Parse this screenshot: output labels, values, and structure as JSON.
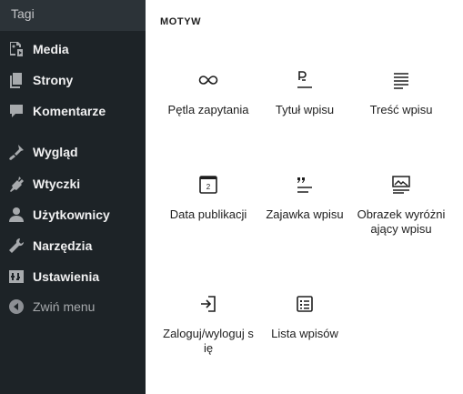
{
  "sidebar": {
    "top_item": "Tagi",
    "items": [
      {
        "label": "Media",
        "icon": "media-icon"
      },
      {
        "label": "Strony",
        "icon": "pages-icon"
      },
      {
        "label": "Komentarze",
        "icon": "comments-icon"
      },
      {
        "label": "Wygląd",
        "icon": "appearance-icon"
      },
      {
        "label": "Wtyczki",
        "icon": "plugins-icon"
      },
      {
        "label": "Użytkownicy",
        "icon": "users-icon"
      },
      {
        "label": "Narzędzia",
        "icon": "tools-icon"
      },
      {
        "label": "Ustawienia",
        "icon": "settings-icon"
      },
      {
        "label": "Zwiń menu",
        "icon": "collapse-icon"
      }
    ]
  },
  "inserter": {
    "section_title": "MOTYW",
    "blocks": [
      {
        "label": "Pętla zapytania",
        "icon": "loop-icon"
      },
      {
        "label": "Tytuł wpisu",
        "icon": "post-title-icon"
      },
      {
        "label": "Treść wpisu",
        "icon": "post-content-icon"
      },
      {
        "label": "Data publikacji",
        "icon": "calendar-icon"
      },
      {
        "label": "Zajawka wpisu",
        "icon": "excerpt-icon"
      },
      {
        "label": "Obrazek wyróżniający wpisu",
        "icon": "featured-image-icon"
      },
      {
        "label": "Zaloguj/wyloguj się",
        "icon": "login-icon"
      },
      {
        "label": "Lista wpisów",
        "icon": "post-list-icon"
      }
    ]
  },
  "colors": {
    "sidebar_bg": "#1d2327",
    "sidebar_text": "#f0f0f1",
    "sidebar_muted": "#a7aaad",
    "icon_gray": "#a7aaad",
    "main_text": "#1e1e1e"
  }
}
